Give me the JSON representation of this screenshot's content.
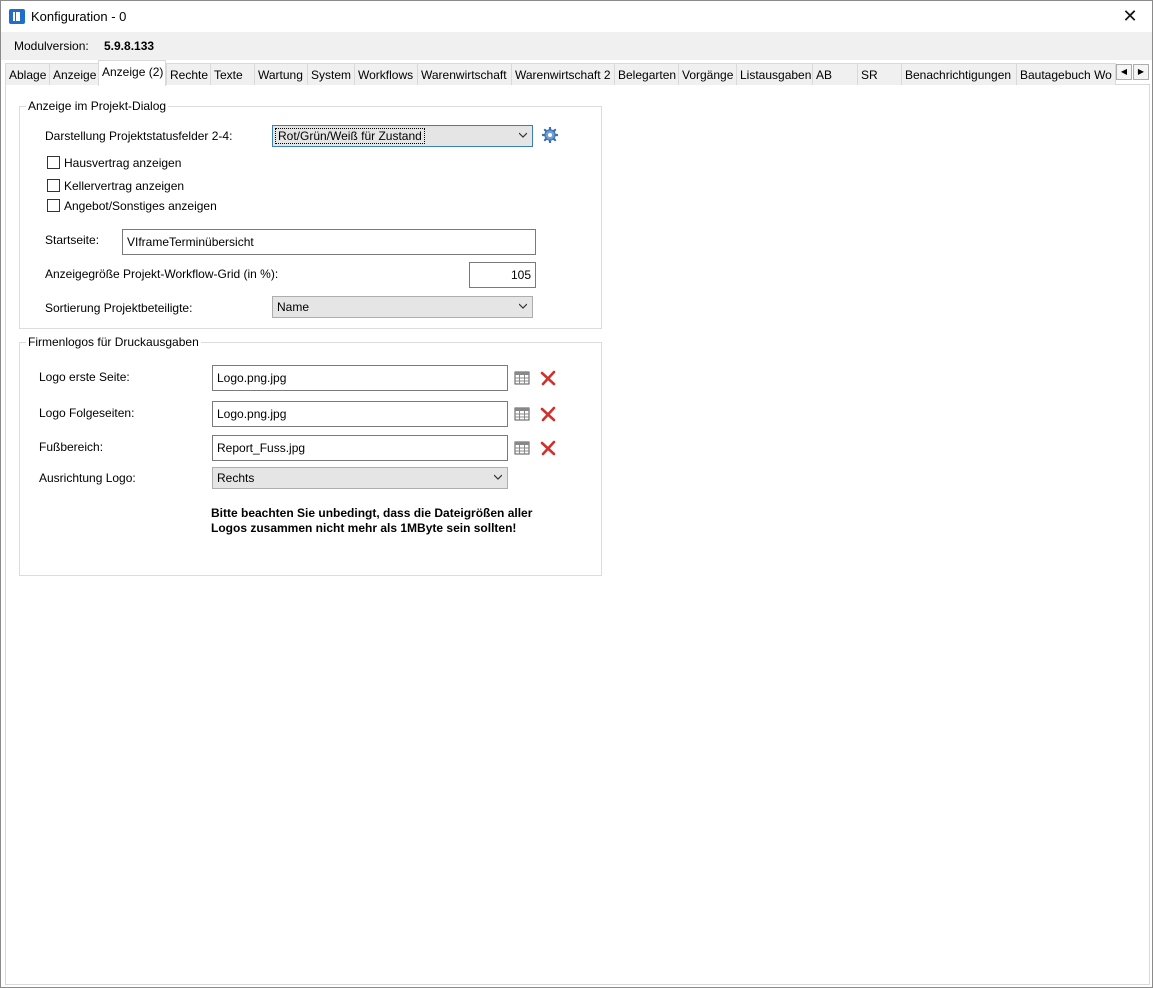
{
  "window": {
    "title": "Konfiguration - 0",
    "close_label": "✕"
  },
  "version": {
    "label": "Modulversion:",
    "value": "5.9.8.133"
  },
  "tabs": [
    {
      "label": "Ablage"
    },
    {
      "label": "Anzeige"
    },
    {
      "label": "Anzeige (2)"
    },
    {
      "label": "Rechte"
    },
    {
      "label": "Texte"
    },
    {
      "label": "Wartung"
    },
    {
      "label": "System"
    },
    {
      "label": "Workflows"
    },
    {
      "label": "Warenwirtschaft"
    },
    {
      "label": "Warenwirtschaft 2"
    },
    {
      "label": "Belegarten"
    },
    {
      "label": "Vorgänge"
    },
    {
      "label": "Listausgaben"
    },
    {
      "label": "AB"
    },
    {
      "label": "SR"
    },
    {
      "label": "Benachrichtigungen"
    },
    {
      "label": "Bautagebuch Wo"
    }
  ],
  "tab_scroll": {
    "left": "◀",
    "right": "▶"
  },
  "project_dialog": {
    "title": "Anzeige im Projekt-Dialog",
    "status_fields_label": "Darstellung Projektstatusfelder 2-4:",
    "status_fields_value": "Rot/Grün/Weiß für Zustand",
    "checkboxes": [
      {
        "label": "Hausvertrag anzeigen",
        "checked": false
      },
      {
        "label": "Kellervertrag anzeigen",
        "checked": false
      },
      {
        "label": "Angebot/Sonstiges anzeigen",
        "checked": false
      }
    ],
    "startpage_label": "Startseite:",
    "startpage_value": "VIframeTerminübersicht",
    "grid_size_label": "Anzeigegröße Projekt-Workflow-Grid (in %):",
    "grid_size_value": "105",
    "sort_label": "Sortierung Projektbeteiligte:",
    "sort_value": "Name"
  },
  "logos": {
    "title": "Firmenlogos für Druckausgaben",
    "first_page_label": "Logo erste Seite:",
    "first_page_value": "Logo.png.jpg",
    "following_label": "Logo Folgeseiten:",
    "following_value": "Logo.png.jpg",
    "footer_label": "Fußbereich:",
    "footer_value": "Report_Fuss.jpg",
    "align_label": "Ausrichtung Logo:",
    "align_value": "Rechts",
    "notice": "Bitte beachten Sie unbedingt, dass die Dateigrößen aller Logos zusammen nicht mehr als 1MByte sein sollten!"
  },
  "colors": {
    "accent": "#1e6fc8",
    "delete": "#d0312d"
  }
}
